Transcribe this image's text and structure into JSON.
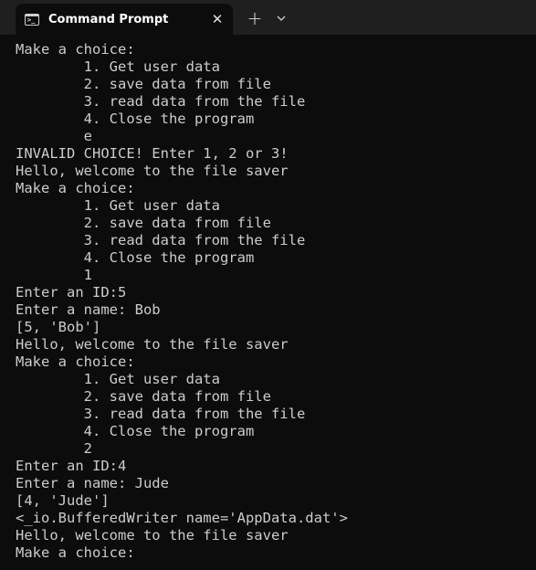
{
  "window": {
    "tab_title": "Command Prompt",
    "close_symbol": "✕",
    "new_tab_symbol": "+",
    "dropdown_symbol": "⌄",
    "icon": "terminal-icon"
  },
  "theme": {
    "titlebar": "#1f1f1f",
    "background": "#0c0c0c",
    "text": "#cccccc"
  },
  "console": {
    "lines": [
      "Make a choice:",
      "        1. Get user data",
      "        2. save data from file",
      "        3. read data from the file",
      "        4. Close the program",
      "        e",
      "INVALID CHOICE! Enter 1, 2 or 3!",
      "Hello, welcome to the file saver",
      "Make a choice:",
      "        1. Get user data",
      "        2. save data from file",
      "        3. read data from the file",
      "        4. Close the program",
      "        1",
      "Enter an ID:5",
      "Enter a name: Bob",
      "[5, 'Bob']",
      "Hello, welcome to the file saver",
      "Make a choice:",
      "        1. Get user data",
      "        2. save data from file",
      "        3. read data from the file",
      "        4. Close the program",
      "        2",
      "Enter an ID:4",
      "Enter a name: Jude",
      "[4, 'Jude']",
      "<_io.BufferedWriter name='AppData.dat'>",
      "Hello, welcome to the file saver",
      "Make a choice:"
    ]
  }
}
